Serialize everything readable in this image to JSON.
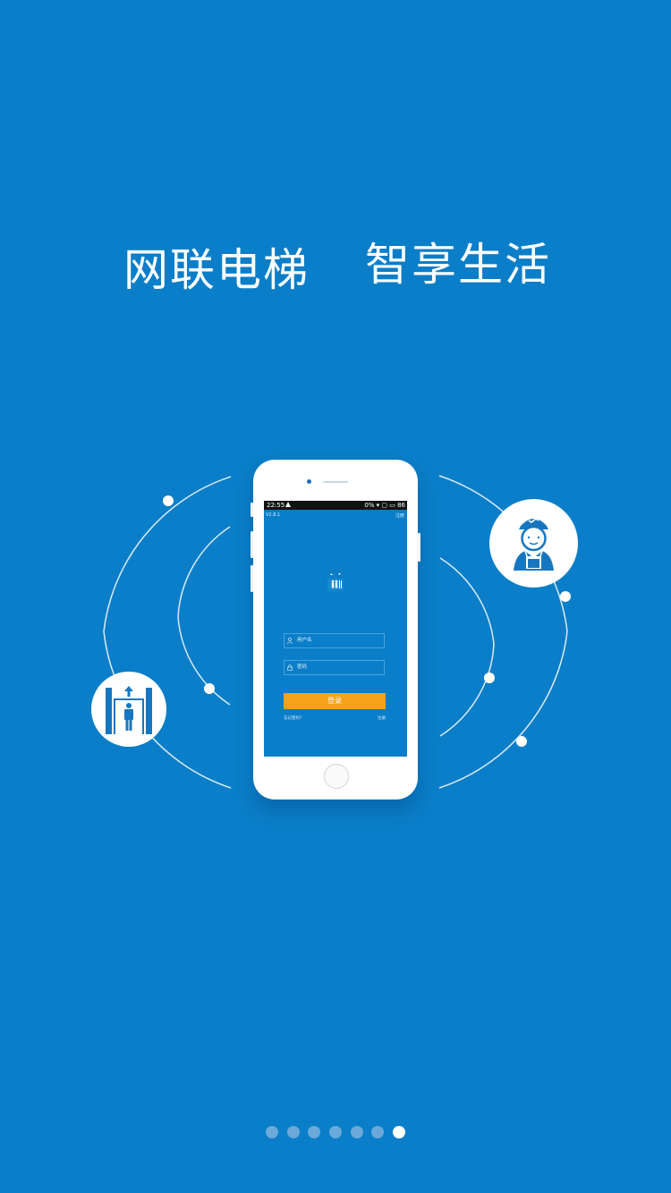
{
  "slogan": {
    "left": "网联电梯",
    "right": "智享生活"
  },
  "colors": {
    "background": "#0a7ec8",
    "accent": "#f7a21b",
    "dot_inactive": "#6aa9d9",
    "dot_active": "#ffffff"
  },
  "phone_screen": {
    "status": {
      "time": "22:55",
      "right": "0% ▾ ▢ ▭ 86"
    },
    "version": "V2.8.1",
    "exit": "注册",
    "username_placeholder": "用户名",
    "password_placeholder": "密码",
    "login_label": "登录",
    "forgot_label": "忘记密码？",
    "register_label": "注册"
  },
  "icons": {
    "elevator": "elevator-icon",
    "worker": "worker-icon",
    "user": "user-icon",
    "lock": "lock-icon"
  },
  "pager": {
    "count": 7,
    "active_index": 6
  }
}
